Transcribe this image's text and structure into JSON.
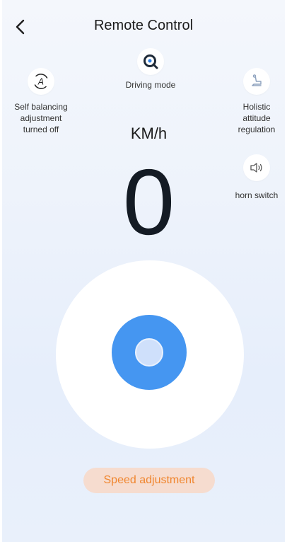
{
  "header": {
    "title": "Remote Control",
    "back_icon": "chevron-left-icon"
  },
  "controls": {
    "driving_mode": {
      "label": "Driving mode",
      "icon": "driving-mode-icon"
    },
    "self_balancing": {
      "label": "Self balancing adjustment turned off",
      "icon": "auto-a-icon"
    },
    "holistic": {
      "label": "Holistic attitude regulation",
      "icon": "seat-icon"
    },
    "horn": {
      "label": "horn switch",
      "icon": "speaker-icon"
    }
  },
  "speed": {
    "unit": "KM/h",
    "value": "0"
  },
  "joystick": {
    "ring_color": "#4596f1",
    "base_color": "#ffffff"
  },
  "speed_button": {
    "label": "Speed adjustment",
    "text_color": "#f0862f",
    "bg_color": "#f6dccf"
  }
}
